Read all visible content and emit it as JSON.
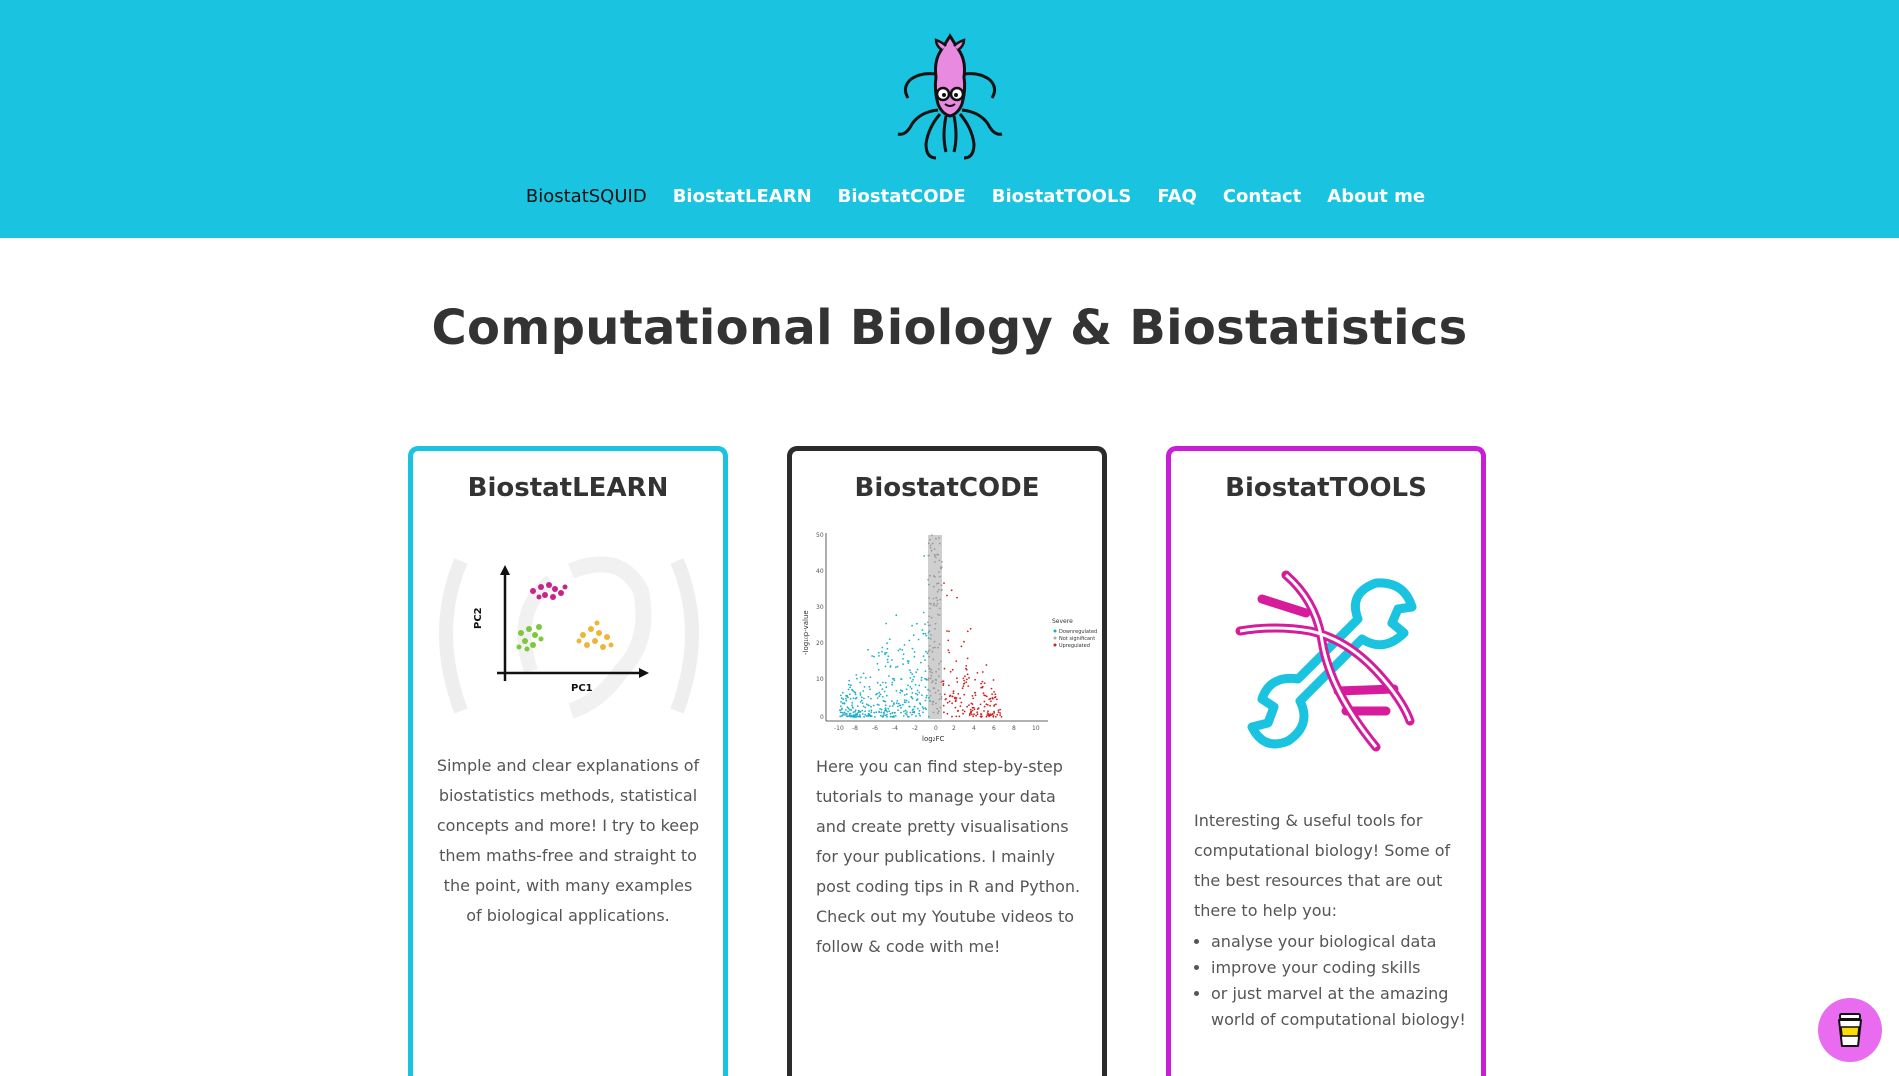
{
  "header": {
    "logo_name": "squid-logo",
    "nav": [
      {
        "label": "BiostatSQUID",
        "active": true
      },
      {
        "label": "BiostatLEARN",
        "active": false
      },
      {
        "label": "BiostatCODE",
        "active": false
      },
      {
        "label": "BiostatTOOLS",
        "active": false
      },
      {
        "label": "FAQ",
        "active": false
      },
      {
        "label": "Contact",
        "active": false
      },
      {
        "label": "About me",
        "active": false
      }
    ]
  },
  "main": {
    "title": "Computational Biology & Biostatistics",
    "cards": [
      {
        "title": "BiostatLEARN",
        "image": "pca-plot-illustration",
        "text": "Simple and clear explanations of biostatistics methods, statistical concepts and more! I try to keep them maths-free and straight to the point, with many examples of biological applications."
      },
      {
        "title": "BiostatCODE",
        "image": "volcano-plot-illustration",
        "text": "Here you can find step-by-step tutorials to manage your data and create pretty visualisations for your publications. I mainly post coding tips in R and Python. Check out my Youtube videos to follow & code with me!"
      },
      {
        "title": "BiostatTOOLS",
        "image": "dna-wrench-icon",
        "text": "Interesting & useful tools for computational biology! Some of the best resources that are out there to help you:",
        "bullets": [
          "analyse your biological data",
          "improve your coding skills",
          "or just marvel at the amazing world of computational biology!"
        ]
      }
    ]
  },
  "figure_text": {
    "pca_x": "PC1",
    "pca_y": "PC2",
    "volcano_x": "log₂FC",
    "volcano_y": "-log₁₀p-value",
    "volcano_legend_title": "Severe",
    "volcano_legend": [
      "Downregulated",
      "Not significant",
      "Upregulated"
    ]
  },
  "floating_button": {
    "icon": "coffee-cup-icon"
  },
  "colors": {
    "header_bg": "#1ac4e0",
    "learn_border": "#1ac4e0",
    "code_border": "#2b2b2b",
    "tools_border": "#c81fd6",
    "button_bg": "#e86bf0"
  }
}
